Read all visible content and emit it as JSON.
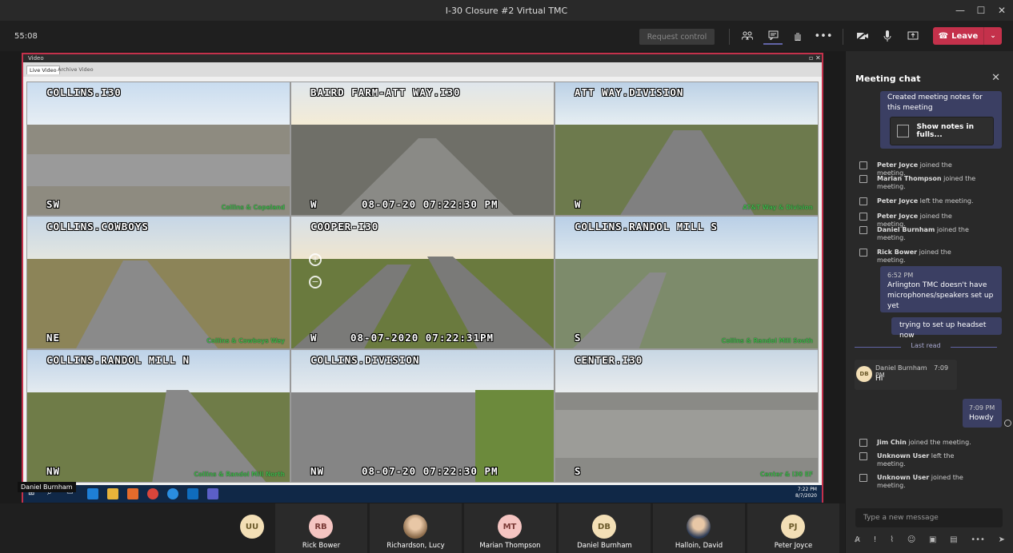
{
  "window": {
    "title": "I-30 Closure #2 Virtual TMC",
    "min": "—",
    "max": "☐",
    "close": "✕"
  },
  "toolbar": {
    "timer": "55:08",
    "request_control": "Request control",
    "leave_label": "Leave",
    "icons": [
      "people-icon",
      "chat-icon",
      "raise-hand-icon",
      "more-icon",
      "camera-off-icon",
      "mic-icon",
      "share-tray-icon"
    ]
  },
  "video": {
    "window_title": "Video",
    "tabs": [
      "Live Video",
      "Archive Video"
    ],
    "cameras": [
      {
        "name": "COLLINS.I30",
        "dir": "SW",
        "ts": "",
        "loc": "Collins & Copeland"
      },
      {
        "name": "BAIRD FARM-ATT WAY.I30",
        "dir": "W",
        "ts": "08-07-20   07:22:30 PM",
        "loc": ""
      },
      {
        "name": "ATT WAY.DIVISION",
        "dir": "W",
        "ts": "",
        "loc": "AT&T Way & Division"
      },
      {
        "name": "COLLINS.COWBOYS",
        "dir": "NE",
        "ts": "",
        "loc": "Collins & Cowboys Way"
      },
      {
        "name": "COOPER-I30",
        "dir": "W",
        "ts": "08-07-2020  07:22:31PM",
        "loc": ""
      },
      {
        "name": "COLLINS.RANDOL MILL S",
        "dir": "S",
        "ts": "",
        "loc": "Collins & Randol Mill South"
      },
      {
        "name": "COLLINS.RANDOL MILL N",
        "dir": "NW",
        "ts": "",
        "loc": "Collins & Randol Mill North"
      },
      {
        "name": "COLLINS.DIVISION",
        "dir": "NW",
        "ts": "08-07-20   07:22:30 PM",
        "loc": ""
      },
      {
        "name": "CENTER.I30",
        "dir": "S",
        "ts": "",
        "loc": "Center & I30 EF"
      }
    ],
    "taskbar_time": "7:22 PM",
    "taskbar_date": "8/7/2020",
    "presenter": "Daniel Burnham"
  },
  "chat": {
    "title": "Meeting chat",
    "notes_text": "Created meeting notes for this meeting",
    "notes_button": "Show notes in fulls...",
    "events_top": [
      {
        "name": "Peter Joyce",
        "action": "joined the meeting."
      },
      {
        "name": "Marian Thompson",
        "action": "joined the meeting."
      },
      {
        "name": "Peter Joyce",
        "action": "left the meeting."
      },
      {
        "name": "Peter Joyce",
        "action": "joined the meeting."
      },
      {
        "name": "Daniel Burnham",
        "action": "joined the meeting."
      },
      {
        "name": "Rick Bower",
        "action": "joined the meeting."
      }
    ],
    "my_time": "6:52 PM",
    "my_msg": "Arlington TMC doesn't have microphones/speakers set up yet",
    "my_msg2": "trying to set up headset now",
    "last_read": "Last read",
    "in_initials": "DB",
    "in_name": "Daniel Burnham",
    "in_time": "7:09 PM",
    "in_msg": "HI",
    "reply_time": "7:09 PM",
    "reply_msg": "Howdy",
    "events_bottom": [
      {
        "name": "Jim Chin",
        "action": "joined the meeting."
      },
      {
        "name": "Unknown User",
        "action": "left the meeting."
      },
      {
        "name": "Unknown User",
        "action": "joined the meeting."
      }
    ],
    "compose_placeholder": "Type a new message"
  },
  "participants": [
    {
      "initials": "UU",
      "name": ""
    },
    {
      "initials": "RB",
      "name": "Rick Bower"
    },
    {
      "initials": "",
      "name": "Richardson, Lucy"
    },
    {
      "initials": "MT",
      "name": "Marian Thompson"
    },
    {
      "initials": "DB",
      "name": "Daniel Burnham"
    },
    {
      "initials": "",
      "name": "Halloin, David"
    },
    {
      "initials": "PJ",
      "name": "Peter Joyce"
    }
  ],
  "colors": {
    "accent": "#6264a7",
    "leave": "#c4314b",
    "loc_green": "#3fb24a"
  }
}
